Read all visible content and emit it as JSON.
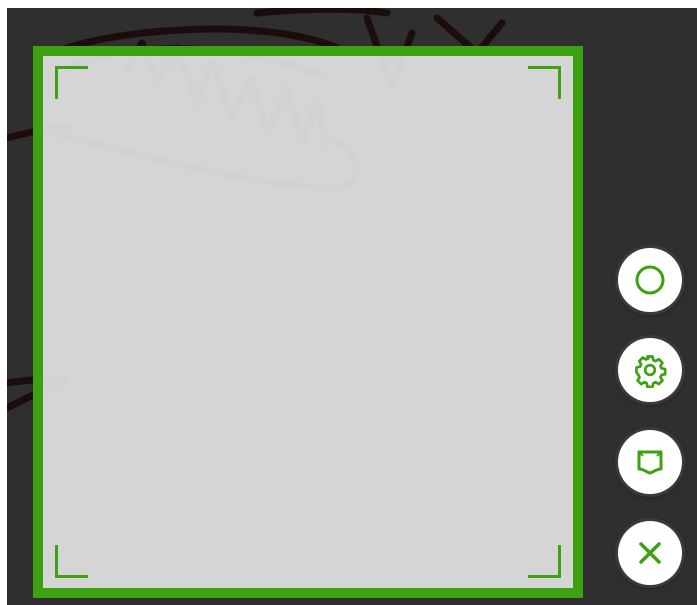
{
  "colors": {
    "accent": "#3ea112",
    "background": "#2f2f2f",
    "crop_fill": "#e8e8e8",
    "ink": "#1d0c0c",
    "button_bg": "#ffffff"
  },
  "toolbar": {
    "buttons": [
      {
        "id": "capture",
        "icon": "circle-icon"
      },
      {
        "id": "settings",
        "icon": "gear-icon"
      },
      {
        "id": "frame",
        "icon": "frame-icon"
      },
      {
        "id": "close",
        "icon": "close-icon"
      }
    ]
  }
}
